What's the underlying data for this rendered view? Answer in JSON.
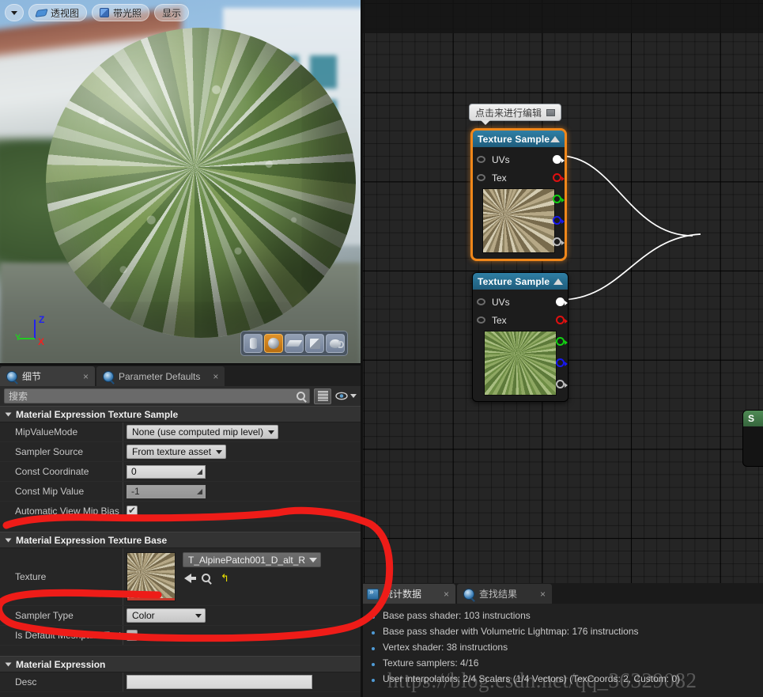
{
  "viewport": {
    "toolbar": {
      "menu_label": "",
      "view_mode_label": "透视图",
      "lighting_label": "带光照",
      "show_label": "显示"
    },
    "shapes": [
      {
        "name": "cylinder",
        "selected": false
      },
      {
        "name": "sphere",
        "selected": true
      },
      {
        "name": "plane",
        "selected": false
      },
      {
        "name": "cube",
        "selected": false
      },
      {
        "name": "teapot",
        "selected": false
      }
    ],
    "axis": {
      "x": "X",
      "y": "Y",
      "z": "Z",
      "x_color": "#ee2222",
      "y_color": "#22cc22",
      "z_color": "#2222ee"
    }
  },
  "details": {
    "tabs": [
      {
        "label": "细节",
        "active": true,
        "close": "×"
      },
      {
        "label": "Parameter Defaults",
        "active": false,
        "close": "×"
      }
    ],
    "search_placeholder": "搜索",
    "categories": [
      {
        "title": "Material Expression Texture Sample",
        "rows": [
          {
            "name": "MipValueMode",
            "type": "combo",
            "value": "None (use computed mip level)"
          },
          {
            "name": "Sampler Source",
            "type": "combo",
            "value": "From texture asset"
          },
          {
            "name": "Const Coordinate",
            "type": "number",
            "value": "0",
            "disabled": false
          },
          {
            "name": "Const Mip Value",
            "type": "number",
            "value": "-1",
            "disabled": true
          },
          {
            "name": "Automatic View Mip Bias",
            "type": "checkbox",
            "value": "checked"
          }
        ]
      },
      {
        "title": "Material Expression Texture Base",
        "rows": [
          {
            "name": "Texture",
            "type": "asset",
            "value": "T_AlpinePatch001_D_alt_R"
          },
          {
            "name": "Sampler Type",
            "type": "combo",
            "value": "Color"
          },
          {
            "name": "Is Default Meshpaint Texture",
            "type": "checkbox",
            "value": "unchecked"
          }
        ]
      },
      {
        "title": "Material Expression",
        "rows": [
          {
            "name": "Desc",
            "type": "text",
            "value": ""
          }
        ]
      }
    ]
  },
  "graph": {
    "tooltip": "点击来进行编辑",
    "nodes": [
      {
        "title": "Texture Sample",
        "selected": true,
        "thumb": "rock-texture",
        "inputs": [
          "UVs",
          "Tex"
        ],
        "outputs": [
          {
            "name": "RGB",
            "color": "#ffffff",
            "filled": true
          },
          {
            "name": "R",
            "color": "#e01010",
            "filled": false
          },
          {
            "name": "G",
            "color": "#12d012",
            "filled": false
          },
          {
            "name": "B",
            "color": "#1818ef",
            "filled": false
          },
          {
            "name": "A",
            "color": "#bdbdbd",
            "filled": false
          }
        ]
      },
      {
        "title": "Texture Sample",
        "selected": false,
        "thumb": "grass-texture",
        "inputs": [
          "UVs",
          "Tex"
        ],
        "outputs": [
          {
            "name": "RGB",
            "color": "#ffffff",
            "filled": true
          },
          {
            "name": "R",
            "color": "#e01010",
            "filled": false
          },
          {
            "name": "G",
            "color": "#12d012",
            "filled": false
          },
          {
            "name": "B",
            "color": "#1818ef",
            "filled": false
          },
          {
            "name": "A",
            "color": "#bdbdbd",
            "filled": false
          }
        ]
      }
    ],
    "partial_node": {
      "title": "S"
    }
  },
  "stats": {
    "tabs": [
      {
        "label": "统计数据",
        "active": true,
        "close": "×"
      },
      {
        "label": "查找结果",
        "active": false,
        "close": "×"
      }
    ],
    "lines": [
      "Base pass shader: 103 instructions",
      "Base pass shader with Volumetric Lightmap: 176 instructions",
      "Vertex shader: 38 instructions",
      "Texture samplers: 4/16",
      "User interpolators: 2/4 Scalars (1/4 Vectors) (TexCoords: 2, Custom: 0)"
    ]
  },
  "watermark": "https://blog.csdn.net/qq_36329082",
  "colors": {
    "selection_orange": "#f0871a",
    "node_header_blue": "#2f7fa5",
    "annotation_red": "#ee1c18",
    "accent_blue": "#4f9bd6"
  }
}
